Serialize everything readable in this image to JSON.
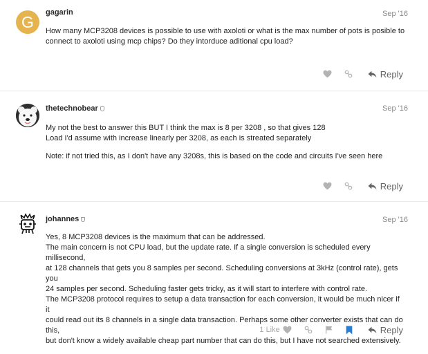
{
  "posts": [
    {
      "avatar_letter": "G",
      "username": "gagarin",
      "date": "Sep '16",
      "paragraphs": [
        [
          "How many MCP3208 devices is possible to use with axoloti or what is the max number of pots is posible to",
          "connect to axoloti using mcp chips? Do they intorduce aditional cpu load?"
        ]
      ],
      "reply_label": "Reply"
    },
    {
      "username": "thetechnobear",
      "date": "Sep '16",
      "paragraphs": [
        [
          "My not the best to answer this BUT I think the max is 8 per 3208 , so that gives 128",
          "Load I'd assume with increase linearly per 3208, as each is streated separately"
        ],
        [
          "Note: if not tried this, as I don't have any 3208s, this is based on the code and circuits I've seen here"
        ]
      ],
      "reply_label": "Reply"
    },
    {
      "username": "johannes",
      "date": "Sep '16",
      "paragraphs": [
        [
          "Yes, 8 MCP3208 devices is the maximum that can be addressed.",
          "The main concern is not CPU load, but the update rate. If a single conversion is scheduled every millisecond,",
          "at 128 channels that gets you 8 samples per second. Scheduling conversions at 3kHz (control rate), gets you",
          "24 samples per second. Scheduling faster gets tricky, as it will start to interfere with control rate.",
          "The MCP3208 protocol requires to setup a data transaction for each conversion, it would be much nicer if it",
          "could read out its 8 channels in a single data transaction. Perhaps some other converter exists that can do this,",
          "but don't know a widely available cheap part number that can do this, but I have not searched extensively."
        ]
      ],
      "likes_label": "1 Like",
      "reply_label": "Reply"
    }
  ],
  "colors": {
    "avatar_gagarin": "#e5b44e",
    "icon_gray": "#a8a8a8",
    "bookmark_blue": "#2a7fd4",
    "reply_text": "#646464"
  },
  "icons": [
    "heart-icon",
    "link-icon",
    "flag-icon",
    "bookmark-icon",
    "reply-arrow-icon",
    "moderator-shield-icon"
  ]
}
